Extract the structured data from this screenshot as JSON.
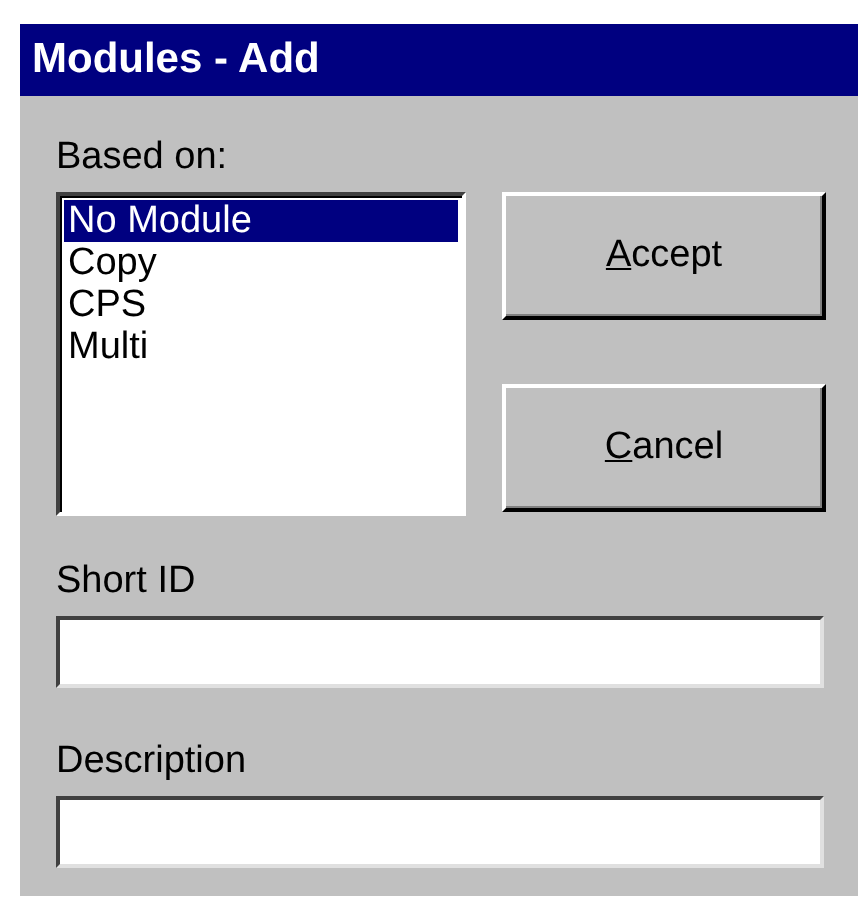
{
  "window": {
    "title": "Modules - Add"
  },
  "based_on": {
    "label": "Based on:",
    "items": [
      {
        "label": "No Module",
        "selected": true
      },
      {
        "label": "Copy",
        "selected": false
      },
      {
        "label": "CPS",
        "selected": false
      },
      {
        "label": "Multi",
        "selected": false
      }
    ]
  },
  "buttons": [
    {
      "label": "Accept"
    },
    {
      "label": "Cancel"
    }
  ],
  "fields": [
    {
      "label": "Short ID"
    },
    {
      "label": "Description"
    }
  ]
}
